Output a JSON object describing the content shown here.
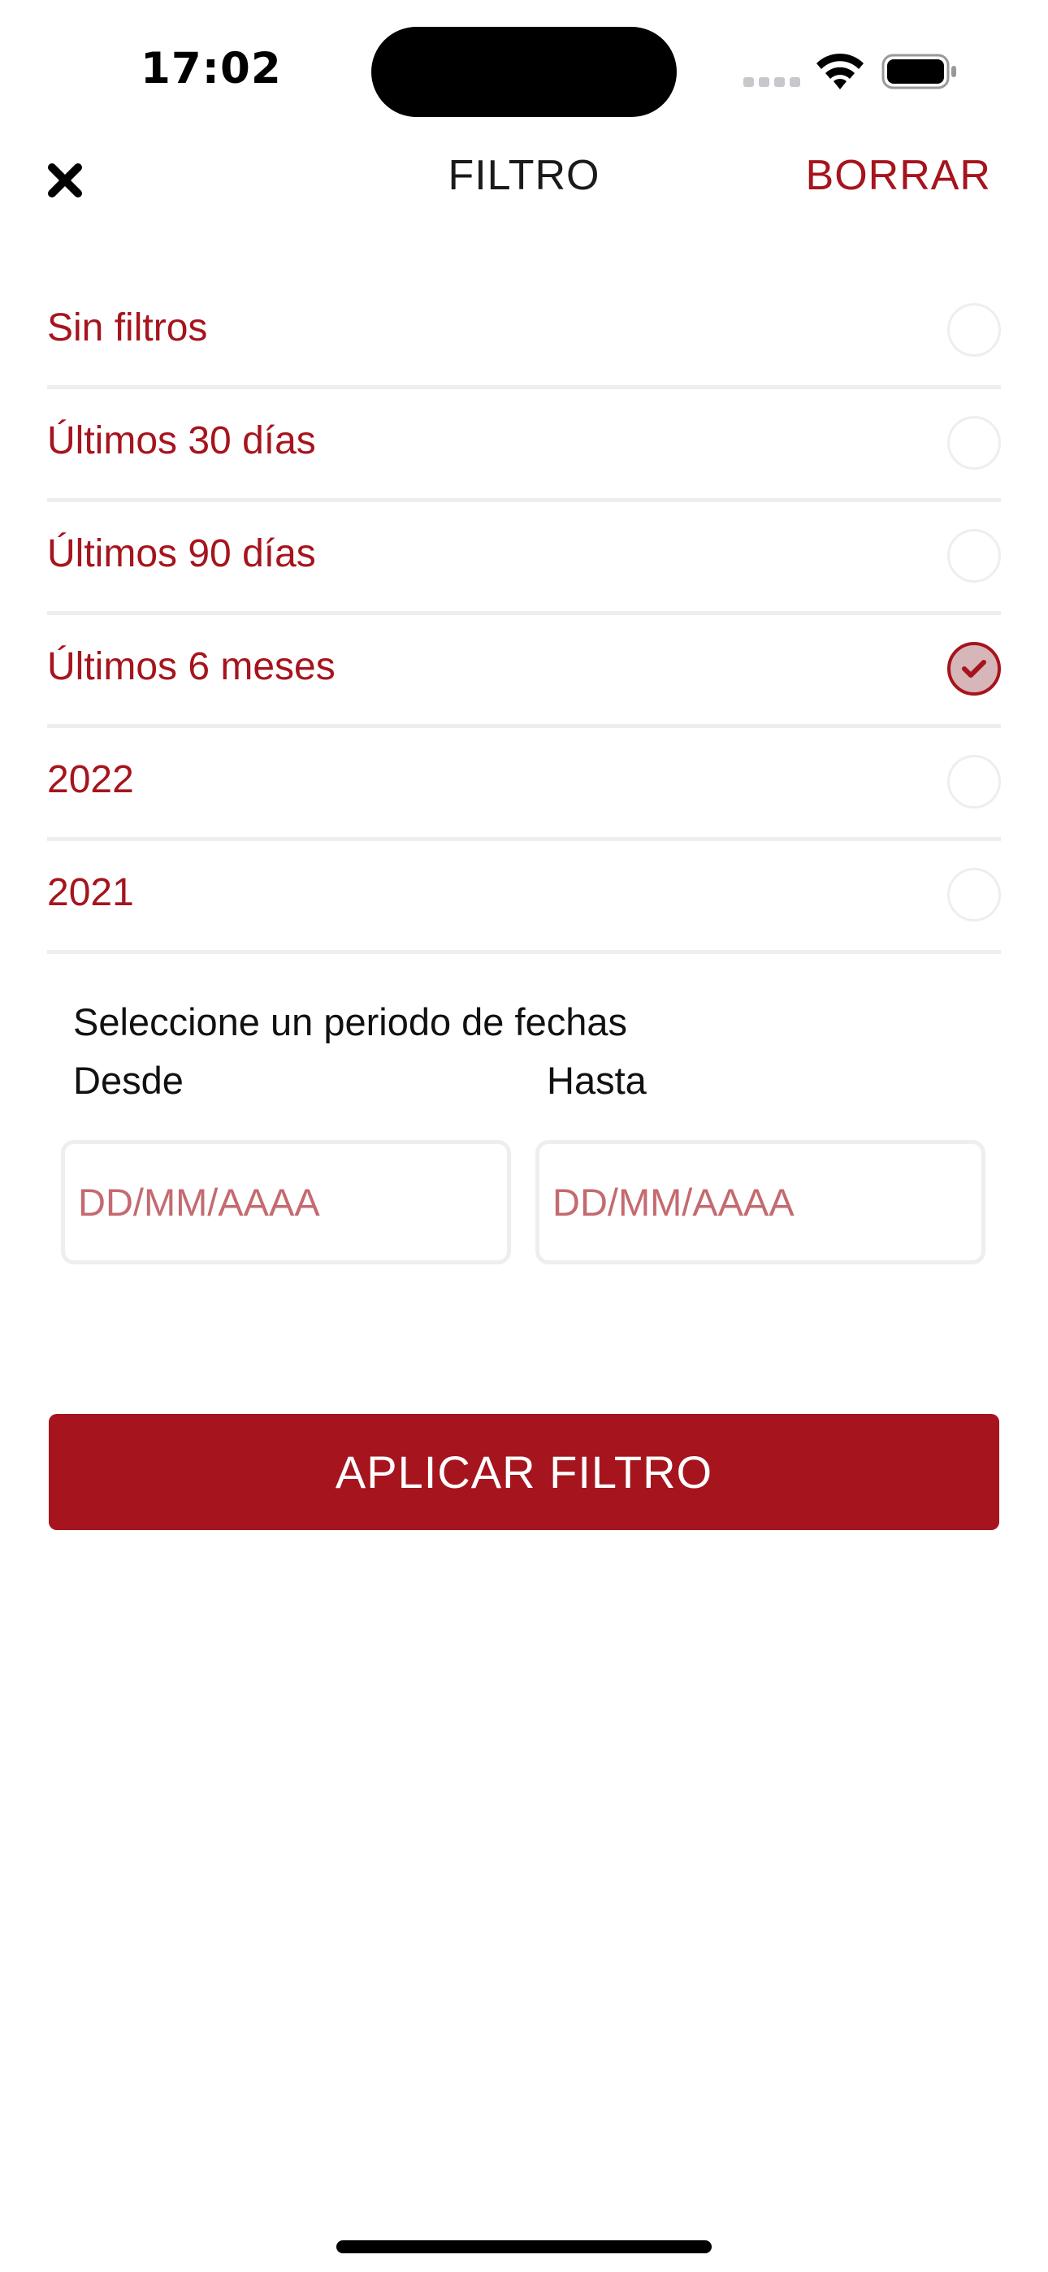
{
  "status_bar": {
    "time": "17:02"
  },
  "header": {
    "title": "FILTRO",
    "clear_label": "BORRAR"
  },
  "options": [
    {
      "label": "Sin filtros",
      "selected": false
    },
    {
      "label": "Últimos 30 días",
      "selected": false
    },
    {
      "label": "Últimos 90 días",
      "selected": false
    },
    {
      "label": "Últimos 6 meses",
      "selected": true
    },
    {
      "label": "2022",
      "selected": false
    },
    {
      "label": "2021",
      "selected": false
    }
  ],
  "date_range": {
    "prompt": "Seleccione un periodo de fechas",
    "from_label": "Desde",
    "to_label": "Hasta",
    "from_placeholder": "DD/MM/AAAA",
    "to_placeholder": "DD/MM/AAAA"
  },
  "apply_button": {
    "label": "APLICAR FILTRO"
  },
  "colors": {
    "accent": "#a6141d",
    "selected_fill": "#d6b6b8",
    "divider": "#eeeeee",
    "placeholder": "#c46a70"
  }
}
